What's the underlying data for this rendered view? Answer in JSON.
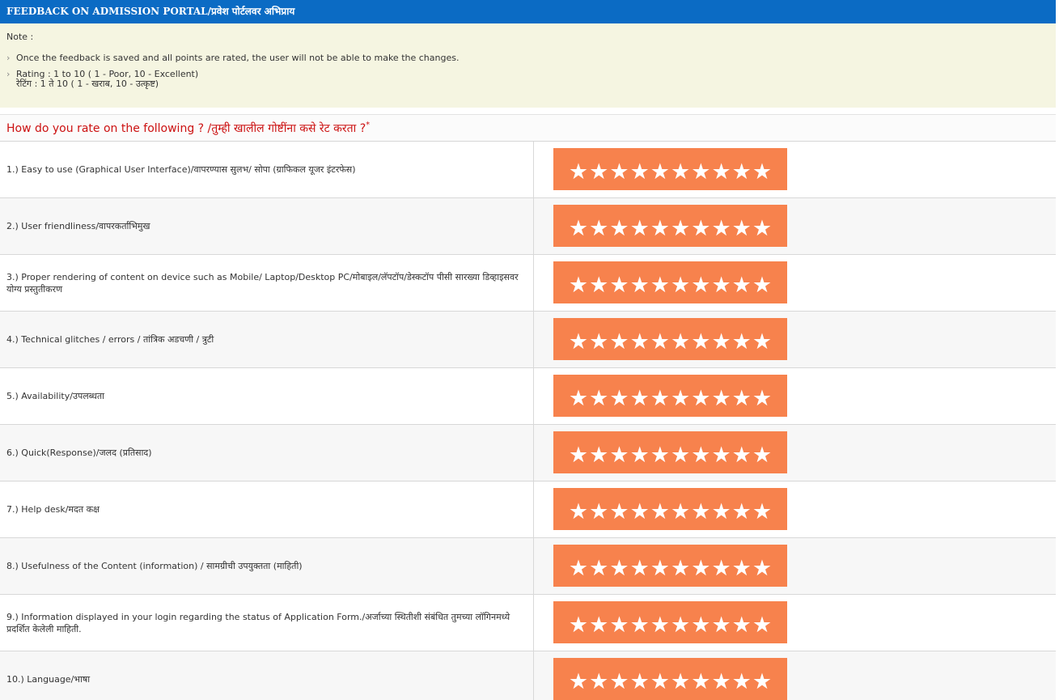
{
  "header": {
    "title": "FEEDBACK ON ADMISSION PORTAL/प्रवेश पोर्टलवर अभिप्राय"
  },
  "note": {
    "title": "Note :",
    "items": [
      {
        "line1": "Once the feedback is saved and all points are rated, the user will not be able to make the changes.",
        "line2": ""
      },
      {
        "line1": "Rating : 1 to 10 ( 1 - Poor, 10 - Excellent)",
        "line2": "रेटिंग : 1 ते 10 ( 1 - खराब, 10 - उत्कृष्ट)"
      }
    ]
  },
  "question": {
    "text": "How do you rate on the following ? /तुम्ही खालील गोष्टींना कसे रेट करता ?",
    "required_mark": "*"
  },
  "colors": {
    "header_bg": "#0b6bc4",
    "note_bg": "#f5f5e1",
    "question_text": "#cc1111",
    "rating_bg": "#f7824d",
    "star": "#ffffff"
  },
  "rating": {
    "max": 10,
    "star_icon": "star-icon"
  },
  "rows": [
    {
      "label": "1.) Easy to use (Graphical User Interface)/वापरण्यास सुलभ/ सोपा (ग्राफिकल यूजर इंटरफेस)"
    },
    {
      "label": "2.) User friendliness/वापरकर्तांभिमुख"
    },
    {
      "label": "3.) Proper rendering of content on device such as Mobile/ Laptop/Desktop PC/मोबाइल/लॅपटॉप/डेस्कटॉप पीसी सारख्या डिव्हाइसवर योग्य प्रस्तुतीकरण"
    },
    {
      "label": "4.) Technical glitches / errors / तांत्रिक अडचणी / त्रुटी"
    },
    {
      "label": "5.) Availability/उपलब्धता"
    },
    {
      "label": "6.) Quick(Response)/जलद (प्रतिसाद)"
    },
    {
      "label": "7.) Help desk/मदत कक्ष"
    },
    {
      "label": "8.) Usefulness of the Content (information) / सामग्रीची उपयुक्तता (माहिती)"
    },
    {
      "label": "9.) Information displayed in your login regarding the status of Application Form./अर्जाच्या स्थितीशी संबंधित तुमच्या लॉगिनमध्ये प्रदर्शित केलेली माहिती."
    },
    {
      "label": "10.) Language/भाषा"
    }
  ]
}
